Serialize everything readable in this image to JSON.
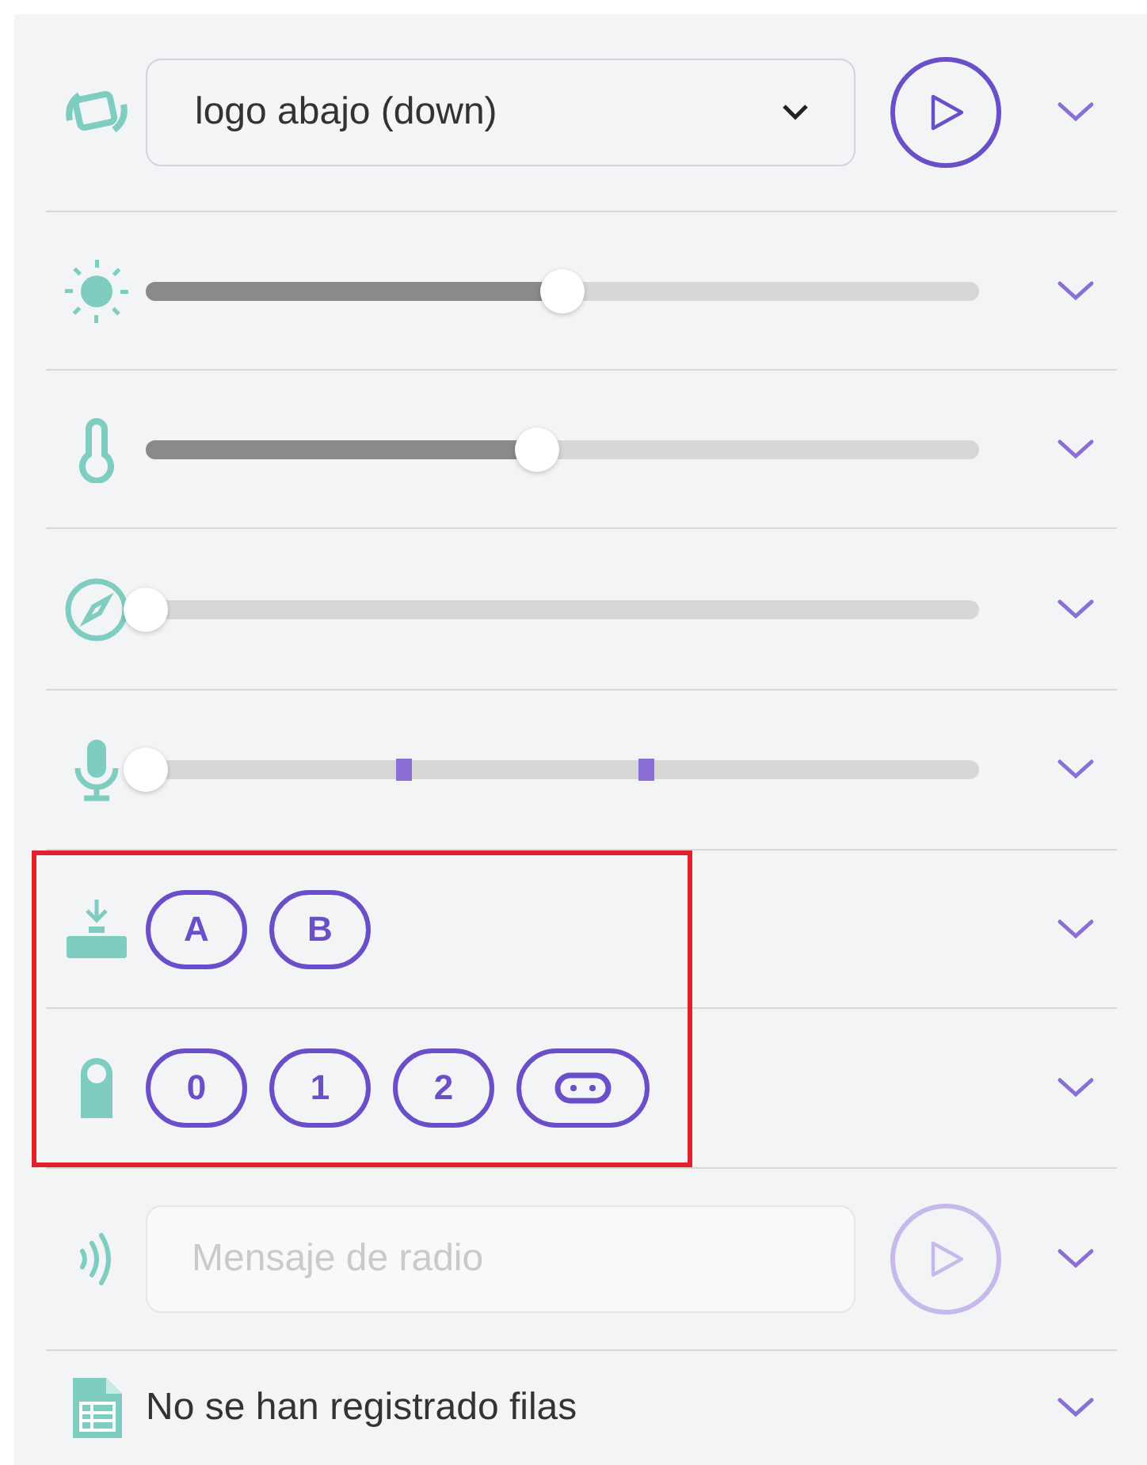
{
  "rows": [
    {
      "kind": "select",
      "value": "logo abajo (down)",
      "send_disabled": false
    },
    {
      "kind": "slider",
      "level": 0.5
    },
    {
      "kind": "slider",
      "level": 0.47
    },
    {
      "kind": "slider",
      "level": 0
    },
    {
      "kind": "slider",
      "level": 0,
      "markers": [
        {
          "level": 0.31
        },
        {
          "level": 0.6
        }
      ]
    },
    {
      "kind": "buttons",
      "highlighted": true,
      "buttons": [
        {
          "label": "A"
        },
        {
          "label": "B"
        }
      ]
    },
    {
      "kind": "buttons",
      "highlighted": true,
      "buttons": [
        {
          "label": "0"
        },
        {
          "label": "1"
        },
        {
          "label": "2"
        },
        {
          "kind": "logo"
        }
      ]
    },
    {
      "kind": "input",
      "placeholder": "Mensaje de radio",
      "send_disabled": true
    },
    {
      "kind": "text",
      "text": "No se han registrado filas"
    }
  ]
}
